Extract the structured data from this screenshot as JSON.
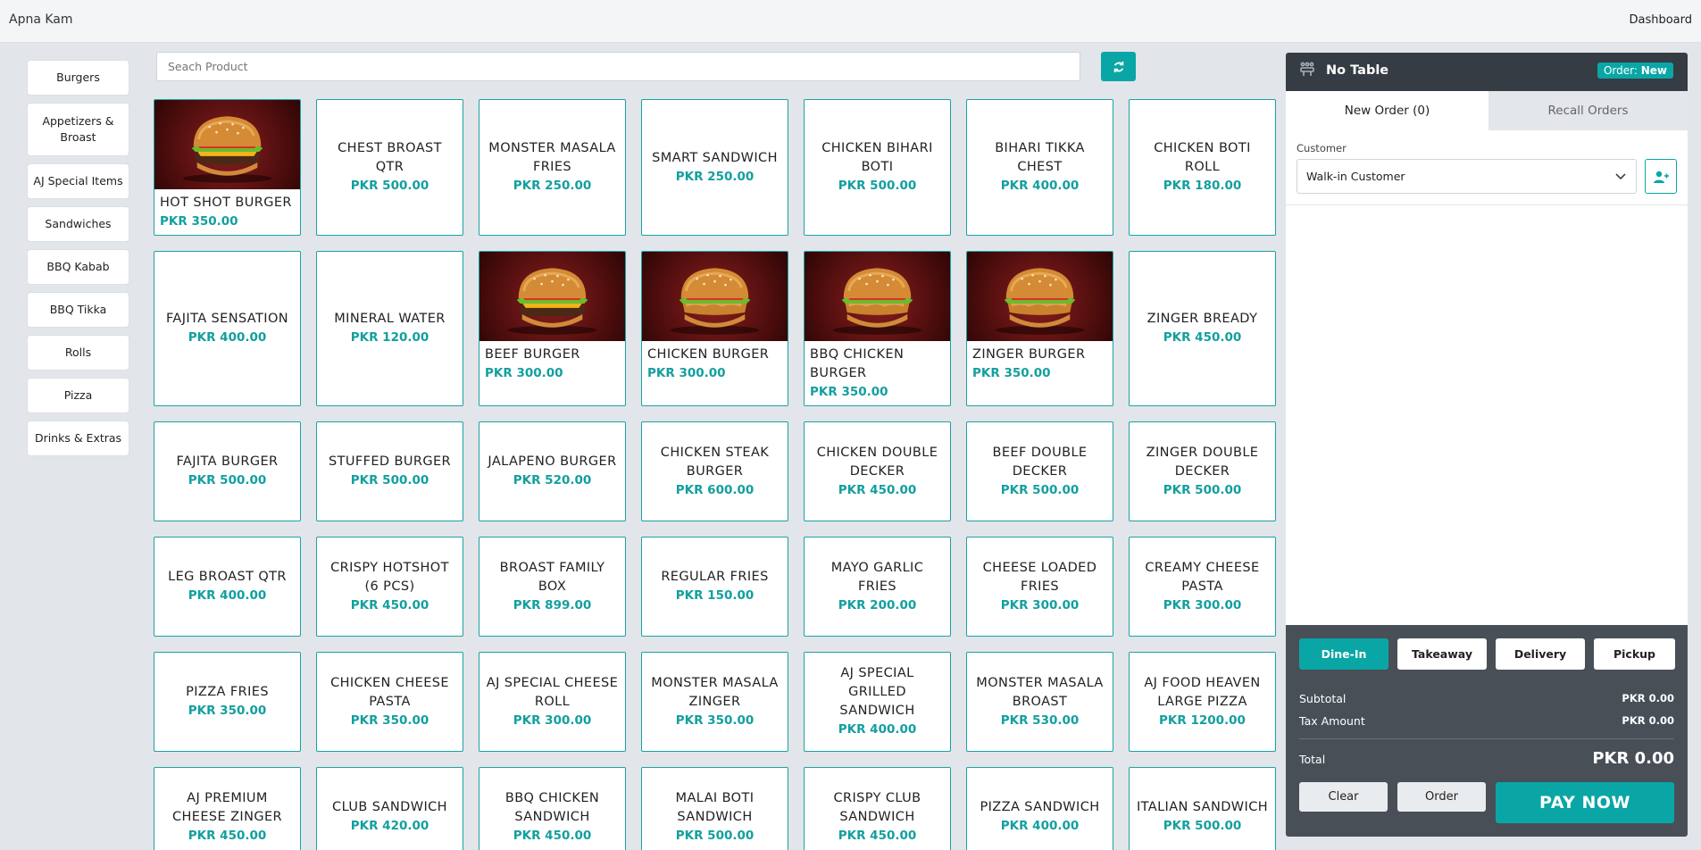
{
  "app": {
    "title": "Apna Kam",
    "dashboard_link": "Dashboard"
  },
  "search": {
    "placeholder": "Seach Product"
  },
  "categories": [
    "Burgers",
    "Appetizers & Broast",
    "AJ Special Items",
    "Sandwiches",
    "BBQ Kabab",
    "BBQ Tikka",
    "Rolls",
    "Pizza",
    "Drinks & Extras"
  ],
  "products": [
    {
      "name": "HOT SHOT BURGER",
      "price": "PKR 350.00",
      "image": "burger-beef-icon"
    },
    {
      "name": "CHEST BROAST QTR",
      "price": "PKR 500.00"
    },
    {
      "name": "MONSTER MASALA FRIES",
      "price": "PKR 250.00"
    },
    {
      "name": "SMART SANDWICH",
      "price": "PKR 250.00"
    },
    {
      "name": "CHICKEN BIHARI BOTI",
      "price": "PKR 500.00"
    },
    {
      "name": "BIHARI TIKKA CHEST",
      "price": "PKR 400.00"
    },
    {
      "name": "CHICKEN BOTI ROLL",
      "price": "PKR 180.00"
    },
    {
      "name": "FAJITA SENSATION",
      "price": "PKR 400.00"
    },
    {
      "name": "MINERAL WATER",
      "price": "PKR 120.00"
    },
    {
      "name": "BEEF BURGER",
      "price": "PKR 300.00",
      "image": "burger-beef-icon"
    },
    {
      "name": "CHICKEN BURGER",
      "price": "PKR 300.00",
      "image": "burger-chicken-icon"
    },
    {
      "name": "BBQ CHICKEN BURGER",
      "price": "PKR 350.00",
      "image": "burger-chicken-icon"
    },
    {
      "name": "ZINGER BURGER",
      "price": "PKR 350.00",
      "image": "burger-chicken-icon"
    },
    {
      "name": "ZINGER BREADY",
      "price": "PKR 450.00"
    },
    {
      "name": "FAJITA BURGER",
      "price": "PKR 500.00"
    },
    {
      "name": "STUFFED BURGER",
      "price": "PKR 500.00"
    },
    {
      "name": "JALAPENO BURGER",
      "price": "PKR 520.00"
    },
    {
      "name": "CHICKEN STEAK BURGER",
      "price": "PKR 600.00"
    },
    {
      "name": "CHICKEN DOUBLE DECKER",
      "price": "PKR 450.00"
    },
    {
      "name": "BEEF DOUBLE DECKER",
      "price": "PKR 500.00"
    },
    {
      "name": "ZINGER DOUBLE DECKER",
      "price": "PKR 500.00"
    },
    {
      "name": "LEG BROAST QTR",
      "price": "PKR 400.00"
    },
    {
      "name": "CRISPY HOTSHOT (6 PCS)",
      "price": "PKR 450.00"
    },
    {
      "name": "BROAST FAMILY BOX",
      "price": "PKR 899.00"
    },
    {
      "name": "REGULAR FRIES",
      "price": "PKR 150.00"
    },
    {
      "name": "MAYO GARLIC FRIES",
      "price": "PKR 200.00"
    },
    {
      "name": "CHEESE LOADED FRIES",
      "price": "PKR 300.00"
    },
    {
      "name": "CREAMY CHEESE PASTA",
      "price": "PKR 300.00"
    },
    {
      "name": "PIZZA FRIES",
      "price": "PKR 350.00"
    },
    {
      "name": "CHICKEN CHEESE PASTA",
      "price": "PKR 350.00"
    },
    {
      "name": "AJ SPECIAL CHEESE ROLL",
      "price": "PKR 300.00"
    },
    {
      "name": "MONSTER MASALA ZINGER",
      "price": "PKR 350.00"
    },
    {
      "name": "AJ SPECIAL GRILLED SANDWICH",
      "price": "PKR 400.00"
    },
    {
      "name": "MONSTER MASALA BROAST",
      "price": "PKR 530.00"
    },
    {
      "name": "AJ FOOD HEAVEN LARGE PIZZA",
      "price": "PKR 1200.00"
    },
    {
      "name": "AJ PREMIUM CHEESE ZINGER",
      "price": "PKR 450.00"
    },
    {
      "name": "CLUB SANDWICH",
      "price": "PKR 420.00"
    },
    {
      "name": "BBQ CHICKEN SANDWICH",
      "price": "PKR 450.00"
    },
    {
      "name": "MALAI BOTI SANDWICH",
      "price": "PKR 500.00"
    },
    {
      "name": "CRISPY CLUB SANDWICH",
      "price": "PKR 450.00"
    },
    {
      "name": "PIZZA SANDWICH",
      "price": "PKR 400.00"
    },
    {
      "name": "ITALIAN SANDWICH",
      "price": "PKR 500.00"
    }
  ],
  "order_panel": {
    "table": "No Table",
    "badge_prefix": "Order:",
    "badge_state": "New",
    "tabs": [
      "New Order (0)",
      "Recall Orders"
    ],
    "customer_label": "Customer",
    "customer_value": "Walk-in Customer",
    "order_types": [
      "Dine-In",
      "Takeaway",
      "Delivery",
      "Pickup"
    ],
    "active_order_type": "Dine-In",
    "subtotal_label": "Subtotal",
    "subtotal": "PKR 0.00",
    "tax_label": "Tax Amount",
    "tax": "PKR 0.00",
    "total_label": "Total",
    "total": "PKR 0.00",
    "clear_label": "Clear",
    "order_label": "Order",
    "pay_label": "PAY NOW"
  },
  "colors": {
    "accent": "#0aa6a6",
    "panel_dark": "#363c43",
    "footer_dark": "#484f57"
  }
}
